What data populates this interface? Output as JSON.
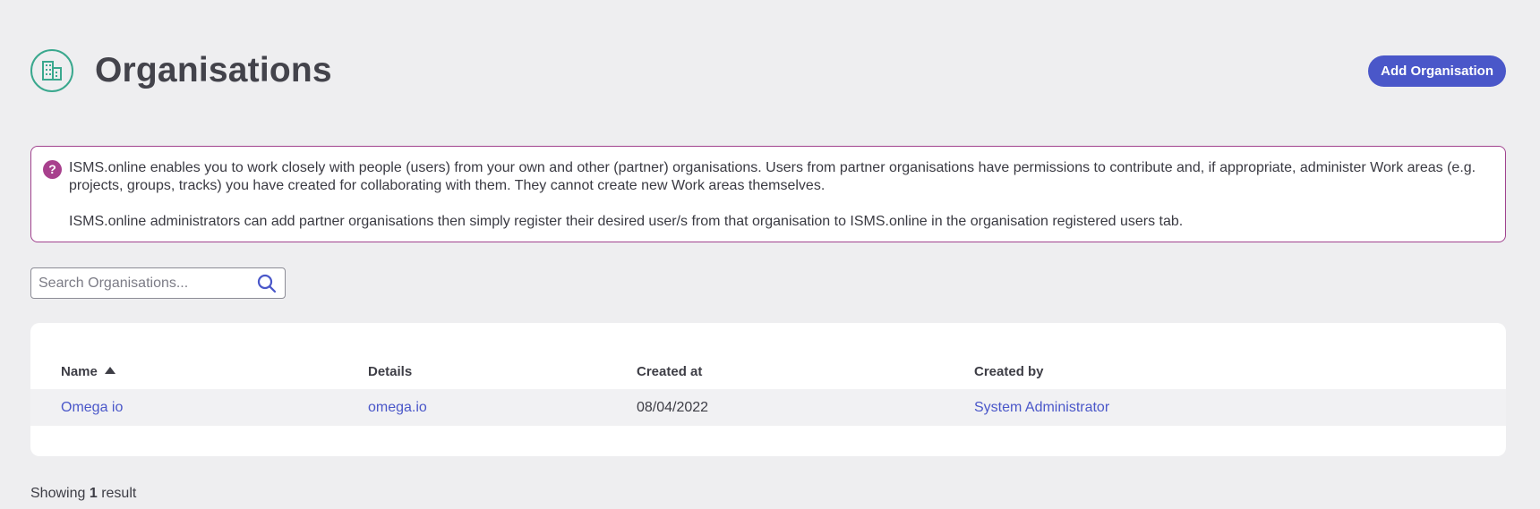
{
  "header": {
    "title": "Organisations",
    "icon": "building-icon",
    "add_button_label": "Add Organisation",
    "accent_color": "#4a57c9",
    "icon_color": "#3aa88e"
  },
  "info": {
    "icon": "help-icon",
    "paragraph1": "ISMS.online enables you to work closely with people (users) from your own and other (partner) organisations. Users from partner organisations have permissions to contribute and, if appropriate, administer Work areas (e.g. projects, groups, tracks) you have created for collaborating with them. They cannot create new Work areas themselves.",
    "paragraph2": "ISMS.online administrators can add partner organisations then simply register their desired user/s from that organisation to ISMS.online in the organisation registered users tab.",
    "border_color": "#a0428e"
  },
  "search": {
    "placeholder": "Search Organisations...",
    "value": "",
    "icon": "search-icon"
  },
  "table": {
    "columns": [
      "Name",
      "Details",
      "Created at",
      "Created by"
    ],
    "sort": {
      "column": "Name",
      "direction": "ascending"
    },
    "rows": [
      {
        "name": "Omega io",
        "details": "omega.io",
        "created_at": "08/04/2022",
        "created_by": "System Administrator"
      }
    ]
  },
  "footer": {
    "prefix": "Showing",
    "count": "1",
    "suffix": "result"
  }
}
